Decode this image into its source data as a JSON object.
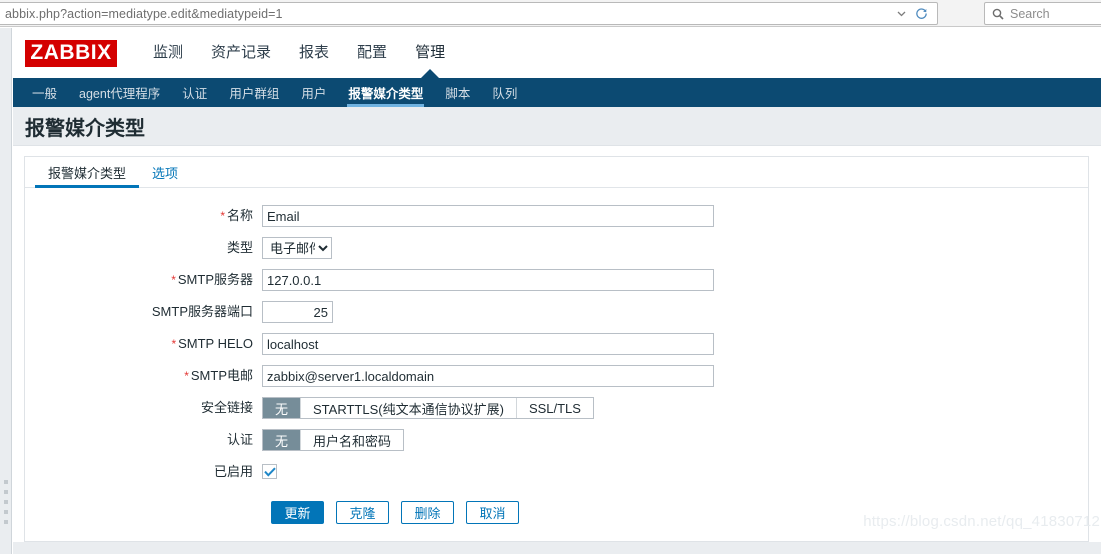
{
  "browser": {
    "url": "abbix.php?action=mediatype.edit&mediatypeid=1",
    "dropdown_icon": "chevron-down-icon",
    "reload_icon": "reload-icon",
    "search_icon": "search-icon",
    "search_placeholder": "Search",
    "search_value": ""
  },
  "colors": {
    "brand_red": "#d40000",
    "nav_navy": "#0c4a72",
    "accent_blue": "#0275b8",
    "tab_underline": "#6fb2e0",
    "segment_selected": "#768d99",
    "required_star": "#e33734",
    "band_gray": "#eaedf0"
  },
  "header": {
    "logo_text": "ZABBIX",
    "primary_nav": [
      {
        "label": "监测",
        "active": false
      },
      {
        "label": "资产记录",
        "active": false
      },
      {
        "label": "报表",
        "active": false
      },
      {
        "label": "配置",
        "active": false
      },
      {
        "label": "管理",
        "active": true
      }
    ],
    "secondary_nav": [
      {
        "label": "一般",
        "active": false
      },
      {
        "label": "agent代理程序",
        "active": false
      },
      {
        "label": "认证",
        "active": false
      },
      {
        "label": "用户群组",
        "active": false
      },
      {
        "label": "用户",
        "active": false
      },
      {
        "label": "报警媒介类型",
        "active": true
      },
      {
        "label": "脚本",
        "active": false
      },
      {
        "label": "队列",
        "active": false
      }
    ]
  },
  "page": {
    "title": "报警媒介类型",
    "tabs": [
      {
        "label": "报警媒介类型",
        "active": true
      },
      {
        "label": "选项",
        "active": false
      }
    ]
  },
  "form": {
    "name": {
      "label": "名称",
      "required": true,
      "value": "Email",
      "placeholder": ""
    },
    "type": {
      "label": "类型",
      "required": false,
      "value": "电子邮件",
      "options": [
        "电子邮件"
      ]
    },
    "smtp_server": {
      "label": "SMTP服务器",
      "required": true,
      "value": "127.0.0.1",
      "placeholder": ""
    },
    "smtp_port": {
      "label": "SMTP服务器端口",
      "required": false,
      "value": "25",
      "placeholder": ""
    },
    "smtp_helo": {
      "label": "SMTP HELO",
      "required": true,
      "value": "localhost",
      "placeholder": ""
    },
    "smtp_email": {
      "label": "SMTP电邮",
      "required": true,
      "value": "zabbix@server1.localdomain",
      "placeholder": ""
    },
    "connection_security": {
      "label": "安全链接",
      "options": [
        {
          "label": "无",
          "selected": true
        },
        {
          "label": "STARTTLS(纯文本通信协议扩展)",
          "selected": false
        },
        {
          "label": "SSL/TLS",
          "selected": false
        }
      ]
    },
    "authentication": {
      "label": "认证",
      "options": [
        {
          "label": "无",
          "selected": true
        },
        {
          "label": "用户名和密码",
          "selected": false
        }
      ]
    },
    "enabled": {
      "label": "已启用",
      "checked": true
    }
  },
  "buttons": [
    {
      "label": "更新",
      "primary": true
    },
    {
      "label": "克隆",
      "primary": false
    },
    {
      "label": "删除",
      "primary": false
    },
    {
      "label": "取消",
      "primary": false
    }
  ],
  "watermark": "https://blog.csdn.net/qq_41830712"
}
